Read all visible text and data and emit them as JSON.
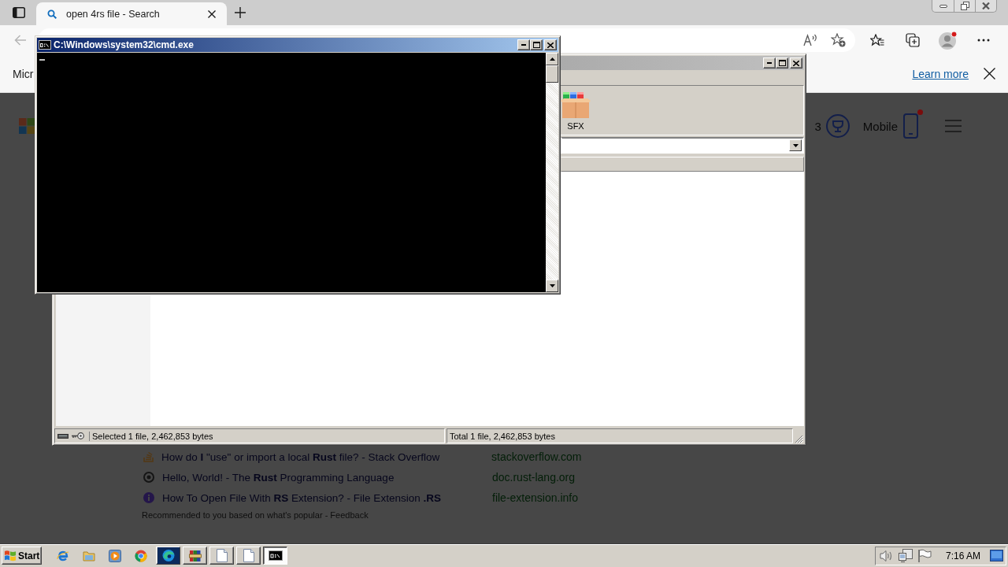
{
  "browser": {
    "tabs": [
      {
        "title": "open 4rs file - Search",
        "selected": true
      }
    ],
    "info_bar": {
      "text": "Micr",
      "link": "Learn more"
    },
    "page": {
      "rewards_count": "3",
      "mobile_label": "Mobile",
      "mobile_notification": true,
      "results": [
        {
          "kind": "forum",
          "title": "How do **I** \"use\" or import a local **Rust** file? - Stack Overflow",
          "source": "stackoverflow.com"
        },
        {
          "kind": "book",
          "title": "Hello, World! - The **Rust** Programming Language",
          "source": "doc.rust-lang.org"
        },
        {
          "kind": "info",
          "title": "How To Open File With **RS** Extension? - File Extension **.RS**",
          "source": "file-extension.info"
        }
      ],
      "footer": "Recommended to you based on what's popular - Feedback"
    }
  },
  "archiver": {
    "active": false,
    "tools": [
      {
        "label": "SFX"
      }
    ],
    "status_bar": [
      "Selected 1 file, 2,462,853 bytes",
      "Total 1 file, 2,462,853 bytes"
    ]
  },
  "console": {
    "title": "C:\\Windows\\system32\\cmd.exe",
    "active": true
  },
  "taskbar": {
    "start": "Start",
    "tasks": [
      {
        "kind": "browser",
        "selected": false
      },
      {
        "kind": "archiver",
        "selected": false
      },
      {
        "kind": "document",
        "selected": false
      },
      {
        "kind": "document",
        "selected": false
      },
      {
        "kind": "console",
        "selected": true
      }
    ],
    "clock": "7:16 AM"
  }
}
